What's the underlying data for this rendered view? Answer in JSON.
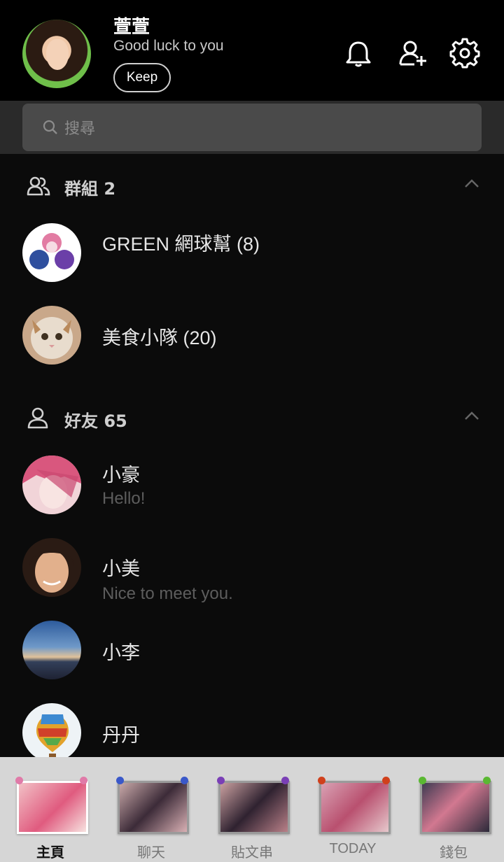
{
  "profile": {
    "name": "萱萱",
    "status": "Good luck to you",
    "keep_label": "Keep"
  },
  "header_icons": [
    "bell-icon",
    "add-friend-icon",
    "settings-gear-icon"
  ],
  "search": {
    "placeholder": "搜尋"
  },
  "groups": {
    "title": "群組 2",
    "items": [
      {
        "name": "GREEN 網球幫 (8)"
      },
      {
        "name": "美食小隊 (20)"
      }
    ]
  },
  "friends": {
    "title": "好友 65",
    "items": [
      {
        "name": "小豪",
        "status": "Hello!"
      },
      {
        "name": "小美",
        "status": "Nice to meet you."
      },
      {
        "name": "小李",
        "status": ""
      },
      {
        "name": "丹丹",
        "status": ""
      }
    ]
  },
  "tabs": [
    {
      "label": "主頁",
      "active": true,
      "pin_color": "#e07aa8"
    },
    {
      "label": "聊天",
      "active": false,
      "pin_color": "#3a58c9"
    },
    {
      "label": "貼文串",
      "active": false,
      "pin_color": "#7a3fb6"
    },
    {
      "label": "TODAY",
      "active": false,
      "pin_color": "#d0401c"
    },
    {
      "label": "錢包",
      "active": false,
      "pin_color": "#5ab832"
    }
  ],
  "colors": {
    "background": "#0b0b0b",
    "header": "#000000",
    "search_bg": "#4a4a4a",
    "tabbar": "#d6d6d6"
  }
}
